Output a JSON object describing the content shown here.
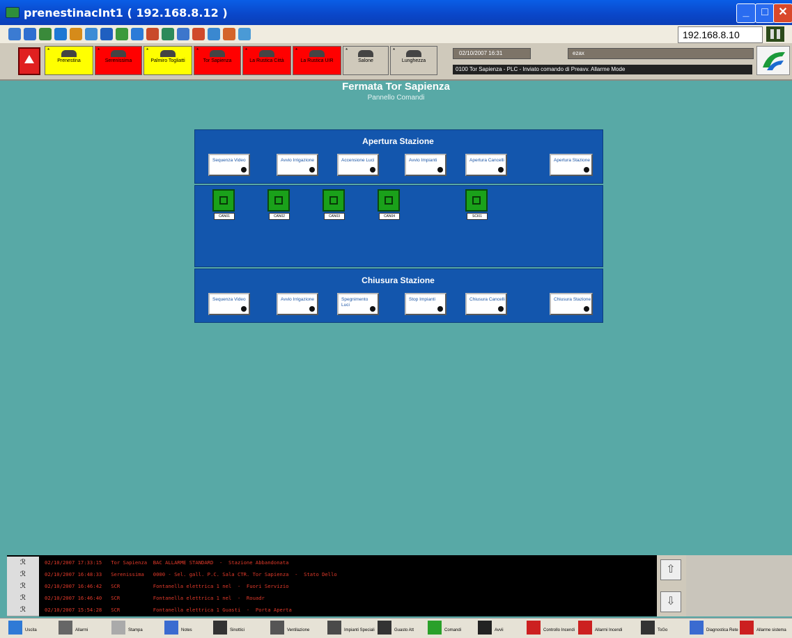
{
  "window": {
    "title": "prenestinacInt1 ( 192.168.8.12 )"
  },
  "toolbar": {
    "ip": "192.168.8.10"
  },
  "stations": [
    {
      "label": "Prenestina",
      "color": "#ffff00"
    },
    {
      "label": "Serenissima",
      "color": "#ff0000"
    },
    {
      "label": "Palmiro Togliatti",
      "color": "#ffff00"
    },
    {
      "label": "Tor Sapienza",
      "color": "#ff0000"
    },
    {
      "label": "La Rustica Città",
      "color": "#ff0000"
    },
    {
      "label": "La Rustica UIR",
      "color": "#ff0000"
    },
    {
      "label": "Salone",
      "color": "#cfc9bb"
    },
    {
      "label": "Lunghezza",
      "color": "#cfc9bb"
    }
  ],
  "status": {
    "datetime": "02/10/2007 16:31",
    "user": "ezax",
    "message": "0100 Tor Sapienza - PLC - Inviato comando di Preavv. Allarme Mode"
  },
  "page": {
    "title": "Fermata Tor Sapienza",
    "subtitle": "Pannello Comandi"
  },
  "apertura": {
    "title": "Apertura Stazione",
    "buttons": [
      "Sequenza Video",
      "Avvio Irrigazione",
      "Accensione Luci",
      "Avvio Impianti",
      "Apertura Cancelli",
      "Apertura Stazione"
    ]
  },
  "devices": [
    "CAN01",
    "CAN02",
    "CAN03",
    "CAN04",
    "SCI01"
  ],
  "chiusura": {
    "title": "Chiusura Stazione",
    "buttons": [
      "Sequenza Video",
      "Avvio Irrigazione",
      "Spegnimento Luci",
      "Stop Impianti",
      "Chiusura Cancelli",
      "Chiusura Stazione"
    ]
  },
  "log": [
    "02/10/2007 17:33:15   Tor Sapienza  BAC ALLARME STANDARD  -  Stazione Abbandonata",
    "02/10/2007 16:48:33   Serenissima   0000 - Sel. gall. P.C. Sala CTR. Tor Sapienza  -  Stato Dello",
    "02/10/2007 16:46:42   SCR           Fontanella elettrica 1 nel  -  Fuori Servizio",
    "02/10/2007 16:46:40   SCR           Fontanella elettrica 1 nel  -  Rouadr",
    "02/10/2007 15:54:28   SCR           Fontanella elettrica 1 Guasti  -  Porta Aperta"
  ],
  "taskbar": [
    "Uscita",
    "Allarmi",
    "Stampa",
    "Notes",
    "Sinottici",
    "Ventilazione",
    "Impianti Speciali",
    "Guasto Att",
    "Comandi",
    "Avvii",
    "Controllo Incendi",
    "Allarmi Incendi",
    "ToGo",
    "Diagnostica Rete",
    "Allarme sistema"
  ],
  "colors": {
    "panel": "#1356ad",
    "background": "#58a9a6",
    "device": "#1aa11a"
  }
}
